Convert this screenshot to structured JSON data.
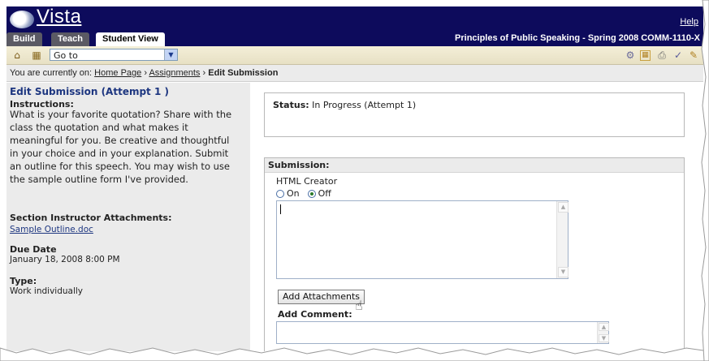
{
  "header": {
    "logo_text": "Vista",
    "help_label": "Help",
    "course_title": "Principles of Public Speaking - Spring 2008 COMM-1110-X"
  },
  "tabs": [
    {
      "label": "Build"
    },
    {
      "label": "Teach"
    },
    {
      "label": "Student View"
    }
  ],
  "toolbar": {
    "goto_value": "Go to"
  },
  "breadcrumb": {
    "prefix": "You are currently on:",
    "home": "Home Page",
    "assignments": "Assignments",
    "current": "Edit Submission",
    "separator": "›"
  },
  "left": {
    "title": "Edit Submission (Attempt 1 )",
    "instructions_label": "Instructions:",
    "instructions_text": "What is your favorite quotation? Share with the class the quotation and what makes it meaningful for you. Be creative and thoughtful in your choice and in your explanation. Submit an outline for this speech. You may wish to use the sample outline form I've provided.",
    "attachments_label": "Section Instructor Attachments:",
    "attachment_link": "Sample Outline.doc",
    "due_label": "Due Date",
    "due_value": "January 18, 2008 8:00 PM",
    "type_label": "Type:",
    "type_value": "Work individually"
  },
  "status": {
    "label": "Status:",
    "value": "In Progress (Attempt 1)"
  },
  "submission": {
    "header": "Submission:",
    "html_creator": "HTML Creator",
    "radio_on": "On",
    "radio_off": "Off",
    "add_attachments": "Add Attachments",
    "add_comment": "Add Comment:"
  }
}
